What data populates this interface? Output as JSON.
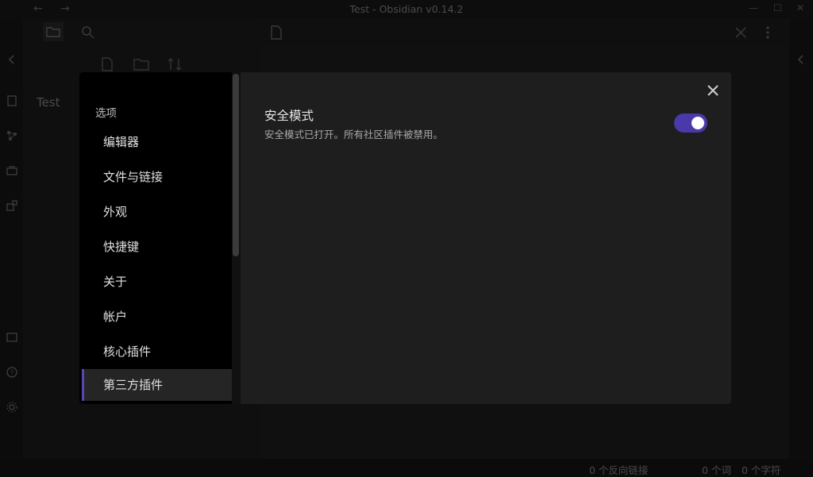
{
  "window": {
    "title": "Test - Obsidian v0.14.2"
  },
  "file_pane": {
    "vault_name": "Test"
  },
  "statusbar": {
    "backlinks": "0 个反向链接",
    "words": "0 个词",
    "chars": "0 个字符"
  },
  "settings": {
    "sidebar": {
      "heading": "选项",
      "items": [
        {
          "label": "编辑器"
        },
        {
          "label": "文件与链接"
        },
        {
          "label": "外观"
        },
        {
          "label": "快捷键"
        },
        {
          "label": "关于"
        },
        {
          "label": "帐户"
        },
        {
          "label": "核心插件"
        },
        {
          "label": "第三方插件"
        }
      ],
      "active_index": 7
    },
    "content": {
      "safe_mode_title": "安全模式",
      "safe_mode_desc": "安全模式已打开。所有社区插件被禁用。",
      "safe_mode_on": true
    }
  },
  "colors": {
    "accent": "#4a39a8",
    "active_border": "#5b43b8",
    "modal_bg": "#1e1e1e",
    "sidebar_bg": "#000000"
  },
  "icons": [
    "back-arrow-icon",
    "forward-arrow-icon",
    "minimize-icon",
    "maximize-icon",
    "close-icon",
    "folder-icon",
    "search-icon",
    "file-icon",
    "new-file-icon",
    "new-folder-icon",
    "sort-icon",
    "collapse-left-icon",
    "collapse-right-icon",
    "more-options-icon",
    "help-icon",
    "gear-icon"
  ]
}
